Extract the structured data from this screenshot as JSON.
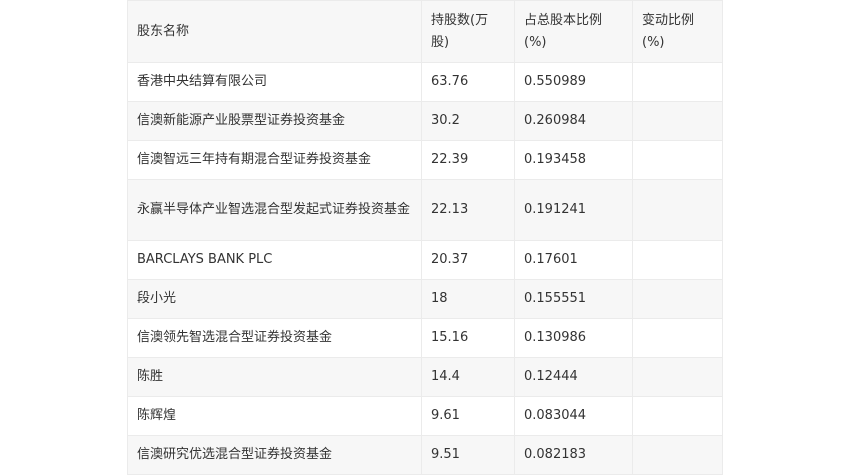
{
  "table": {
    "headers": [
      "股东名称",
      "持股数(万股)",
      "占总股本比例(%)",
      "变动比例(%)"
    ],
    "rows": [
      [
        "香港中央结算有限公司",
        "63.76",
        "0.550989",
        ""
      ],
      [
        "信澳新能源产业股票型证券投资基金",
        "30.2",
        "0.260984",
        ""
      ],
      [
        "信澳智远三年持有期混合型证券投资基金",
        "22.39",
        "0.193458",
        ""
      ],
      [
        "永赢半导体产业智选混合型发起式证券投资基金",
        "22.13",
        "0.191241",
        ""
      ],
      [
        "BARCLAYS BANK PLC",
        "20.37",
        "0.17601",
        ""
      ],
      [
        "段小光",
        "18",
        "0.155551",
        ""
      ],
      [
        "信澳领先智选混合型证券投资基金",
        "15.16",
        "0.130986",
        ""
      ],
      [
        "陈胜",
        "14.4",
        "0.12444",
        ""
      ],
      [
        "陈辉煌",
        "9.61",
        "0.083044",
        ""
      ],
      [
        "信澳研究优选混合型证券投资基金",
        "9.51",
        "0.082183",
        ""
      ]
    ]
  }
}
